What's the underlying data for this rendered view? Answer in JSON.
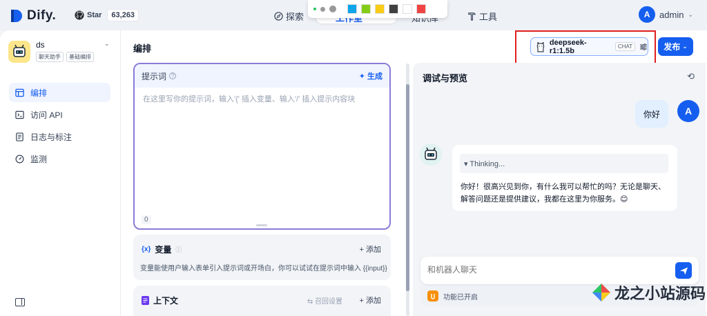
{
  "brand": {
    "name": "Dify."
  },
  "github": {
    "label": "Star",
    "count": "63,263"
  },
  "nav": {
    "explore": "探索",
    "studio": "工作室",
    "knowledge": "知识库",
    "tools": "工具"
  },
  "colors": {
    "accent": "#155eef",
    "swatches": [
      "#0ea5e9",
      "#84cc16",
      "#facc15",
      "#404040",
      "#ffffff",
      "#ef4444"
    ]
  },
  "user": {
    "initial": "A",
    "name": "admin"
  },
  "app": {
    "name": "ds",
    "tags": [
      "聊天助手",
      "基础编排"
    ]
  },
  "sidebar": {
    "items": [
      {
        "label": "编排",
        "icon": "layout-icon"
      },
      {
        "label": "访问 API",
        "icon": "terminal-icon"
      },
      {
        "label": "日志与标注",
        "icon": "doc-icon"
      },
      {
        "label": "监测",
        "icon": "gauge-icon"
      }
    ]
  },
  "main": {
    "title": "编排",
    "model": {
      "name": "deepseek-r1:1.5b",
      "badge": "CHAT"
    },
    "publish": "发布"
  },
  "prompt": {
    "label": "提示词",
    "generate": "生成",
    "placeholder": "在这里写你的提示词，输入'{' 插入变量、输入'/' 插入提示内容块",
    "count": "0"
  },
  "variables": {
    "title": "变量",
    "add": "添加",
    "desc": "变量能使用户输入表单引入提示词或开场白，你可以试试在提示词中输入 {{input}}"
  },
  "context": {
    "title": "上下文",
    "recall": "召回设置",
    "add": "添加"
  },
  "debug": {
    "title": "调试与预览",
    "user_message": "你好",
    "thinking": "▾ Thinking...",
    "bot_message": "你好！很高兴见到你，有什么我可以帮忙的吗？无论是聊天、解答问题还是提供建议，我都在这里为你服务。😊",
    "input_placeholder": "和机器人聊天",
    "features": "功能已开启"
  },
  "watermark": {
    "text": "龙之小站源码"
  }
}
